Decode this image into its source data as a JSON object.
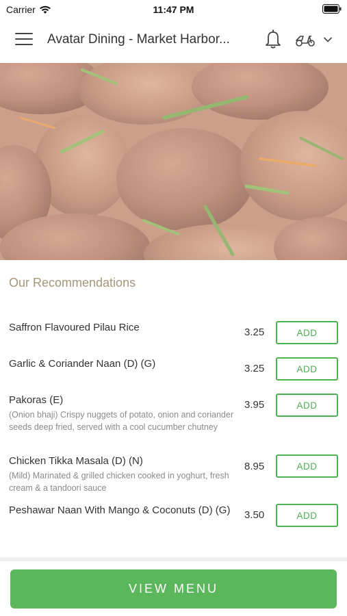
{
  "status_bar": {
    "carrier": "Carrier",
    "time": "11:47 PM"
  },
  "header": {
    "title": "Avatar Dining - Market Harbor...",
    "icons": [
      "hamburger-menu-icon",
      "bell-icon",
      "scooter-icon",
      "chevron-down-icon"
    ]
  },
  "hero": {
    "image": "chicken-curry-photo"
  },
  "recommendations": {
    "title": "Our Recommendations",
    "items": [
      {
        "name": "Saffron Flavoured Pilau Rice",
        "description": "",
        "price": "3.25",
        "button": "ADD"
      },
      {
        "name": "Garlic & Coriander Naan (D) (G)",
        "description": "",
        "price": "3.25",
        "button": "ADD"
      },
      {
        "name": "Pakoras (E)",
        "description": "(Onion bhaji) Crispy nuggets of potato, onion and coriander seeds deep fried, served with a cool cucumber chutney",
        "price": "3.95",
        "button": "ADD"
      },
      {
        "name": "Chicken Tikka Masala (D) (N)",
        "description": "(Mild) Marinated & grilled chicken cooked in yoghurt, fresh cream & a tandoori sauce",
        "price": "8.95",
        "button": "ADD"
      },
      {
        "name": "Peshawar Naan With Mango & Coconuts (D) (G)",
        "description": "",
        "price": "3.50",
        "button": "ADD"
      }
    ]
  },
  "footer": {
    "view_menu_label": "VIEW MENU"
  },
  "colors": {
    "accent_green": "#4caf50",
    "button_green": "#5bb75b",
    "section_title": "#a3977a"
  }
}
